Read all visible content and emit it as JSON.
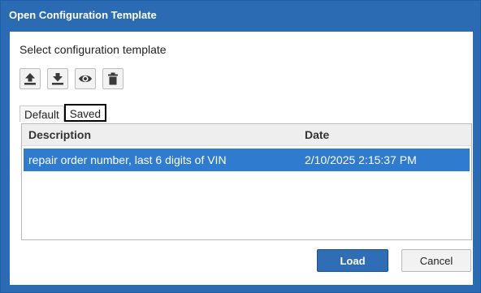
{
  "window": {
    "title": "Open Configuration Template"
  },
  "prompt": "Select configuration template",
  "toolbar": [
    {
      "icon": "upload-icon"
    },
    {
      "icon": "download-icon"
    },
    {
      "icon": "eye-icon"
    },
    {
      "icon": "trash-icon"
    }
  ],
  "tabs": [
    {
      "label": "Default",
      "active": false
    },
    {
      "label": "Saved",
      "active": true
    }
  ],
  "table": {
    "columns": [
      "Description",
      "Date"
    ],
    "rows": [
      {
        "description": "repair order number, last 6 digits of VIN",
        "date": "2/10/2025 2:15:37 PM",
        "selected": true
      }
    ]
  },
  "buttons": {
    "load": "Load",
    "cancel": "Cancel"
  },
  "colors": {
    "titlebar": "#2b6bb3",
    "selection": "#2f7bd0",
    "primary_button": "#2f6db5"
  }
}
